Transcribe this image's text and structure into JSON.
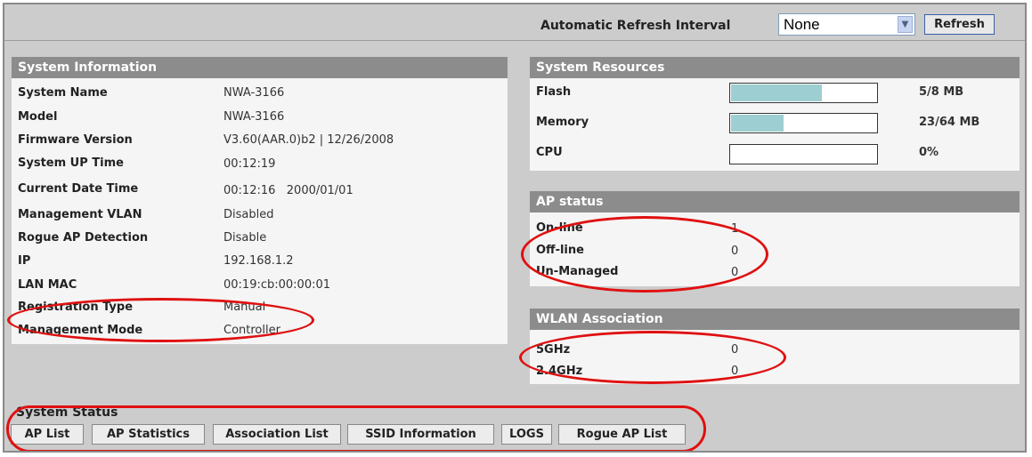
{
  "refresh": {
    "label": "Automatic Refresh Interval",
    "selected": "None",
    "button": "Refresh"
  },
  "system_information": {
    "title": "System Information",
    "rows": [
      {
        "label": "System Name",
        "value": "NWA-3166"
      },
      {
        "label": "Model",
        "value": "NWA-3166"
      },
      {
        "label": "Firmware Version",
        "value": "V3.60(AAR.0)b2 | 12/26/2008"
      },
      {
        "label": "System UP Time",
        "value": "00:12:19"
      },
      {
        "label": "Current Date Time",
        "value": "00:12:16   2000/01/01"
      },
      {
        "label": "Management VLAN",
        "value": "Disabled"
      },
      {
        "label": "Rogue AP Detection",
        "value": "Disable"
      },
      {
        "label": "IP",
        "value": "192.168.1.2"
      },
      {
        "label": "LAN MAC",
        "value": "00:19:cb:00:00:01"
      },
      {
        "label": "Registration Type",
        "value": "Manual"
      },
      {
        "label": "Management Mode",
        "value": "Controller"
      }
    ]
  },
  "system_resources": {
    "title": "System Resources",
    "rows": [
      {
        "label": "Flash",
        "value": "5/8 MB",
        "fill": 0.62
      },
      {
        "label": "Memory",
        "value": "23/64 MB",
        "fill": 0.36
      },
      {
        "label": "CPU",
        "value": "0%",
        "fill": 0
      }
    ]
  },
  "ap_status": {
    "title": "AP status",
    "rows": [
      {
        "label": "On-line",
        "value": "1"
      },
      {
        "label": "Off-line",
        "value": "0"
      },
      {
        "label": "Un-Managed",
        "value": "0"
      }
    ]
  },
  "wlan_association": {
    "title": "WLAN Association",
    "rows": [
      {
        "label": "5GHz",
        "value": "0"
      },
      {
        "label": "2.4GHz",
        "value": "0"
      }
    ]
  },
  "system_status": {
    "title": "System Status",
    "buttons": [
      "AP List",
      "AP Statistics",
      "Association List",
      "SSID Information",
      "LOGS",
      "Rogue AP List"
    ]
  },
  "colors": {
    "annotation": "#e01010",
    "panel_header": "#8c8c8c",
    "bar_fill": "#9dcfd2"
  }
}
